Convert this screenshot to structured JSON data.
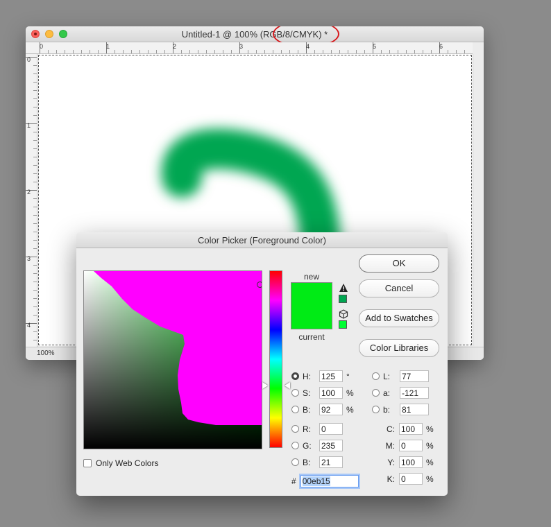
{
  "document": {
    "title": "Untitled-1 @ 100% (RGB/8/CMYK) *",
    "zoom": "100%",
    "ruler_h_labels": [
      "0",
      "1",
      "2",
      "3",
      "4",
      "5",
      "6"
    ],
    "ruler_v_labels": [
      "0",
      "1",
      "2",
      "3",
      "4"
    ],
    "stroke_color": "#00a651",
    "annotation_color": "#d7191c"
  },
  "picker": {
    "title": "Color Picker (Foreground Color)",
    "new_label": "new",
    "current_label": "current",
    "new_color": "#00eb15",
    "current_color": "#00eb15",
    "gamut_color": "#00a651",
    "web_color": "#00ff33",
    "buttons": {
      "ok": "OK",
      "cancel": "Cancel",
      "add_to_swatches": "Add to Swatches",
      "color_libraries": "Color Libraries"
    },
    "only_web_colors": "Only Web Colors",
    "hsb": [
      {
        "label": "H:",
        "value": "125",
        "unit": "°",
        "selected": true
      },
      {
        "label": "S:",
        "value": "100",
        "unit": "%",
        "selected": false
      },
      {
        "label": "B:",
        "value": "92",
        "unit": "%",
        "selected": false
      }
    ],
    "lab": [
      {
        "label": "L:",
        "value": "77"
      },
      {
        "label": "a:",
        "value": "-121"
      },
      {
        "label": "b:",
        "value": "81"
      }
    ],
    "rgb": [
      {
        "label": "R:",
        "value": "0"
      },
      {
        "label": "G:",
        "value": "235"
      },
      {
        "label": "B:",
        "value": "21"
      }
    ],
    "cmyk": [
      {
        "label": "C:",
        "value": "100",
        "unit": "%"
      },
      {
        "label": "M:",
        "value": "0",
        "unit": "%"
      },
      {
        "label": "Y:",
        "value": "100",
        "unit": "%"
      },
      {
        "label": "K:",
        "value": "0",
        "unit": "%"
      }
    ],
    "hex_prefix": "#",
    "hex": "00eb15"
  }
}
